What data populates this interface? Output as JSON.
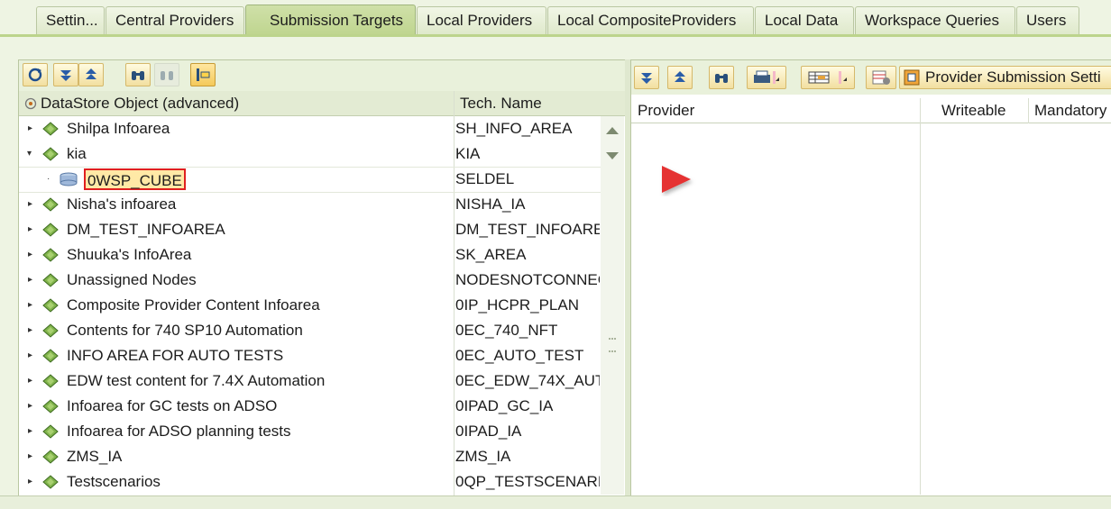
{
  "tabs": [
    {
      "label": "Settin..."
    },
    {
      "label": "Central Providers"
    },
    {
      "label": "Submission Targets",
      "active": true
    },
    {
      "label": "Local Providers"
    },
    {
      "label": "Local CompositeProviders"
    },
    {
      "label": "Local Data"
    },
    {
      "label": "Workspace Queries"
    },
    {
      "label": "Users"
    }
  ],
  "left": {
    "toolbar_icons": [
      "refresh-icon",
      "expand-all-icon",
      "collapse-all-icon",
      "find-icon",
      "find-next-icon",
      "select-icon"
    ],
    "col_name": "DataStore Object (advanced)",
    "col_tech": "Tech. Name",
    "rows": [
      {
        "name": "Shilpa Infoarea",
        "tech": "SH_INFO_AREA",
        "type": "infoarea",
        "expand": "collapsed"
      },
      {
        "name": "kia",
        "tech": "KIA",
        "type": "infoarea",
        "expand": "expanded"
      },
      {
        "name": "0WSP_CUBE",
        "tech": "SELDEL",
        "type": "cube",
        "expand": "leaf"
      },
      {
        "name": "Nisha's infoarea",
        "tech": "NISHA_IA",
        "type": "infoarea",
        "expand": "collapsed"
      },
      {
        "name": "DM_TEST_INFOAREA",
        "tech": "DM_TEST_INFOARE",
        "type": "infoarea",
        "expand": "collapsed"
      },
      {
        "name": "Shuuka's InfoArea",
        "tech": "SK_AREA",
        "type": "infoarea",
        "expand": "collapsed"
      },
      {
        "name": "Unassigned Nodes",
        "tech": "NODESNOTCONNEC",
        "type": "infoarea",
        "expand": "collapsed"
      },
      {
        "name": "Composite Provider Content Infoarea",
        "tech": "0IP_HCPR_PLAN",
        "type": "infoarea",
        "expand": "collapsed"
      },
      {
        "name": "Contents for 740 SP10 Automation",
        "tech": "0EC_740_NFT",
        "type": "infoarea",
        "expand": "collapsed"
      },
      {
        "name": "INFO AREA FOR AUTO TESTS",
        "tech": "0EC_AUTO_TEST",
        "type": "infoarea",
        "expand": "collapsed"
      },
      {
        "name": "EDW test content for 7.4X Automation",
        "tech": "0EC_EDW_74X_AUT",
        "type": "infoarea",
        "expand": "collapsed"
      },
      {
        "name": "Infoarea for GC tests on ADSO",
        "tech": "0IPAD_GC_IA",
        "type": "infoarea",
        "expand": "collapsed"
      },
      {
        "name": "Infoarea for ADSO planning tests",
        "tech": "0IPAD_IA",
        "type": "infoarea",
        "expand": "collapsed"
      },
      {
        "name": "ZMS_IA",
        "tech": "ZMS_IA",
        "type": "infoarea",
        "expand": "collapsed"
      },
      {
        "name": "Testscenarios",
        "tech": "0QP_TESTSCENARI(",
        "type": "infoarea",
        "expand": "collapsed"
      }
    ]
  },
  "right": {
    "toolbar_icons": [
      "expand-all-icon",
      "collapse-all-icon",
      "find-icon",
      "print-icon",
      "layout-icon",
      "delete-row-icon",
      "settings-icon"
    ],
    "settings_label": "Provider Submission Setti",
    "columns": [
      "Provider",
      "Writeable",
      "Mandatory"
    ]
  },
  "colors": {
    "accent_green": "#bcd48c",
    "highlight": "#e02020",
    "arrow": "#e53333"
  }
}
